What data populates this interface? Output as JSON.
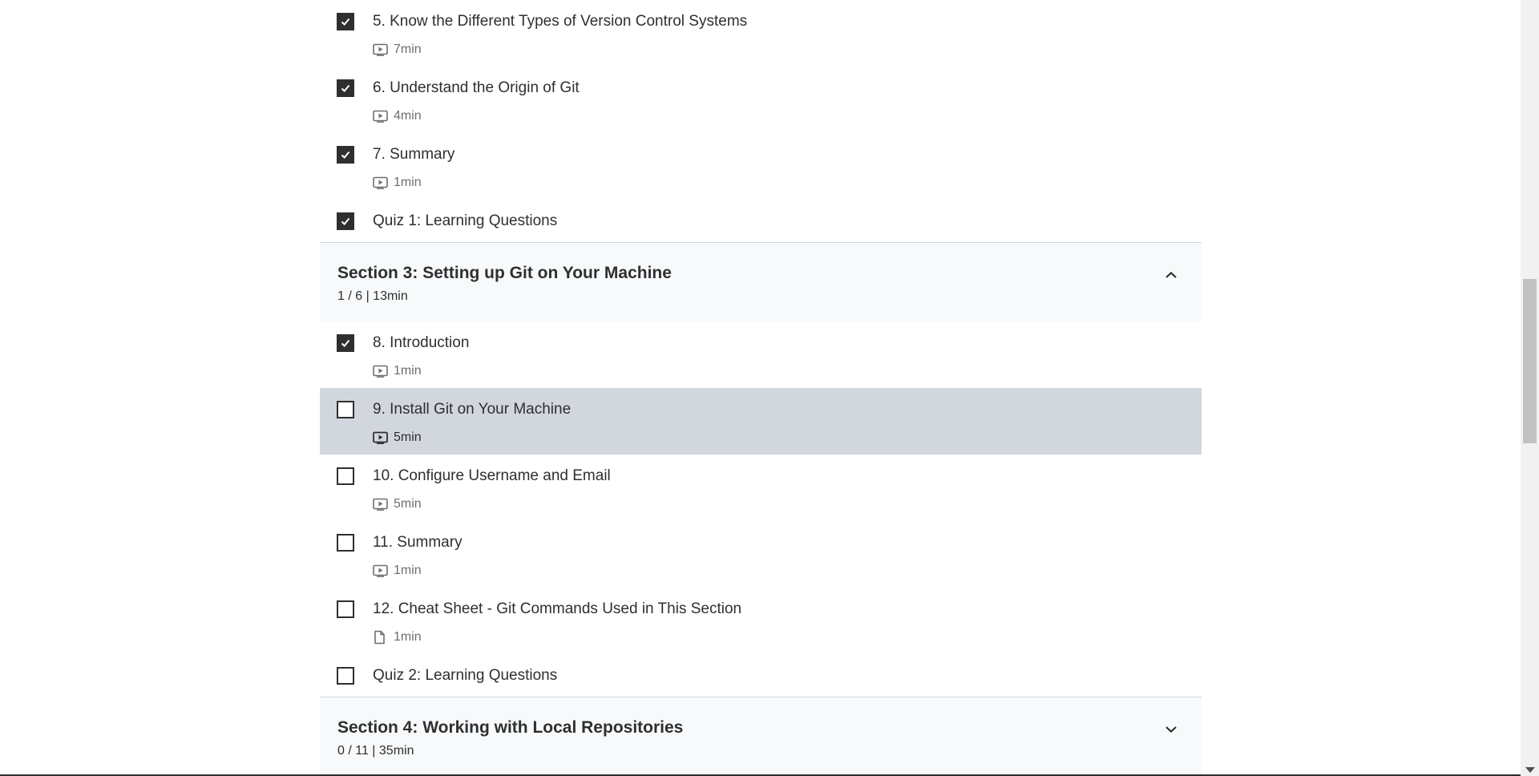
{
  "sections_above": {
    "items": [
      {
        "title": "5. Know the Different Types of Version Control Systems",
        "duration": "7min",
        "type_icon": "video-icon",
        "completed": true
      },
      {
        "title": "6. Understand the Origin of Git",
        "duration": "4min",
        "type_icon": "video-icon",
        "completed": true
      },
      {
        "title": "7. Summary",
        "duration": "1min",
        "type_icon": "video-icon",
        "completed": true
      },
      {
        "title": "Quiz 1: Learning Questions",
        "completed": true
      }
    ]
  },
  "section3": {
    "title": "Section 3: Setting up Git on Your Machine",
    "stats": "1 / 6 | 13min",
    "expanded": true,
    "chevron_icon": "chevron-up-icon",
    "items": [
      {
        "title": "8. Introduction",
        "duration": "1min",
        "type_icon": "video-icon",
        "completed": true
      },
      {
        "title": "9. Install Git on Your Machine",
        "duration": "5min",
        "type_icon": "video-icon",
        "completed": false,
        "active": true
      },
      {
        "title": "10. Configure Username and Email",
        "duration": "5min",
        "type_icon": "video-icon",
        "completed": false
      },
      {
        "title": "11. Summary",
        "duration": "1min",
        "type_icon": "video-icon",
        "completed": false
      },
      {
        "title": "12. Cheat Sheet - Git Commands Used in This Section",
        "duration": "1min",
        "type_icon": "file-icon",
        "completed": false
      },
      {
        "title": "Quiz 2: Learning Questions",
        "completed": false
      }
    ]
  },
  "section4": {
    "title": "Section 4: Working with Local Repositories",
    "stats": "0 / 11 | 35min",
    "expanded": false,
    "chevron_icon": "chevron-down-icon"
  },
  "colors": {
    "text": "#2d2f31",
    "muted": "#6a6f73",
    "active_row": "#d1d7dc",
    "section_bg": "#f7f9fa"
  }
}
